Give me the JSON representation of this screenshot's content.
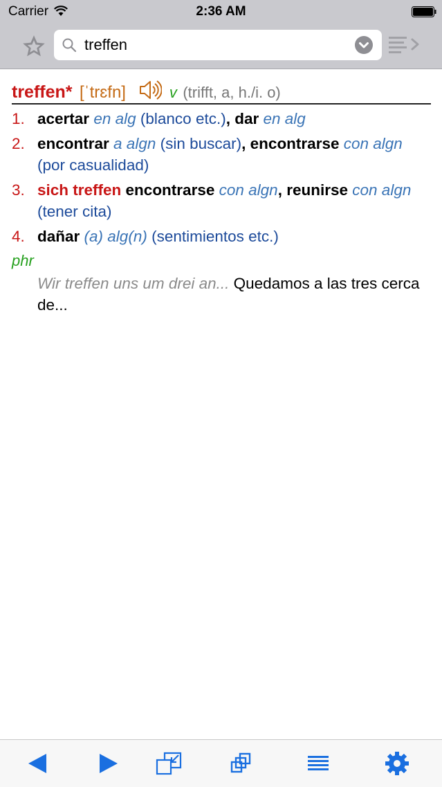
{
  "status": {
    "carrier": "Carrier",
    "time": "2:36 AM"
  },
  "search": {
    "value": "treffen"
  },
  "entry": {
    "headword": "treffen*",
    "pronunciation": "[ˈtrɛfn]",
    "pos": "v",
    "grammar": "(trifft, a, h./i. o)",
    "senses": [
      {
        "num": "1.",
        "parts": [
          {
            "t": "acertar",
            "s": "b"
          },
          {
            "t": " "
          },
          {
            "t": "en alg",
            "s": "it"
          },
          {
            "t": " (blanco etc.)"
          },
          {
            "t": ", ",
            "s": "b"
          },
          {
            "t": "dar",
            "s": "b"
          },
          {
            "t": " "
          },
          {
            "t": "en alg",
            "s": "it"
          }
        ]
      },
      {
        "num": "2.",
        "parts": [
          {
            "t": "encontrar",
            "s": "b"
          },
          {
            "t": " "
          },
          {
            "t": "a algn",
            "s": "it"
          },
          {
            "t": " (sin buscar)"
          },
          {
            "t": ", ",
            "s": "b"
          },
          {
            "t": "encontrarse",
            "s": "b"
          },
          {
            "t": " "
          },
          {
            "t": "con algn",
            "s": "it"
          },
          {
            "t": " (por casualidad)"
          }
        ]
      },
      {
        "num": "3.",
        "parts": [
          {
            "t": "sich treffen",
            "s": "red"
          },
          {
            "t": " "
          },
          {
            "t": "encontrarse",
            "s": "b"
          },
          {
            "t": " "
          },
          {
            "t": "con algn",
            "s": "it"
          },
          {
            "t": ", ",
            "s": "b"
          },
          {
            "t": "reunirse",
            "s": "b"
          },
          {
            "t": " "
          },
          {
            "t": "con algn",
            "s": "it"
          },
          {
            "t": " (tener cita)"
          }
        ]
      },
      {
        "num": "4.",
        "parts": [
          {
            "t": "dañar",
            "s": "b"
          },
          {
            "t": " "
          },
          {
            "t": "(a) alg(n)",
            "s": "it"
          },
          {
            "t": " (sentimientos etc.)"
          }
        ]
      }
    ],
    "phrase_label": "phr",
    "example": {
      "source": "Wir treffen uns um drei an...",
      "translation": " Quedamos a las tres cerca de..."
    }
  },
  "colors": {
    "headword": "#c81616",
    "pronunciation": "#c46a14",
    "pos": "#26a01e",
    "toolbar_icons": "#1a6fe0"
  },
  "toolbar": {
    "icons": [
      "back-arrow-icon",
      "forward-arrow-icon",
      "window-shrink-icon",
      "windows-icon",
      "list-lines-icon",
      "gear-icon"
    ]
  }
}
